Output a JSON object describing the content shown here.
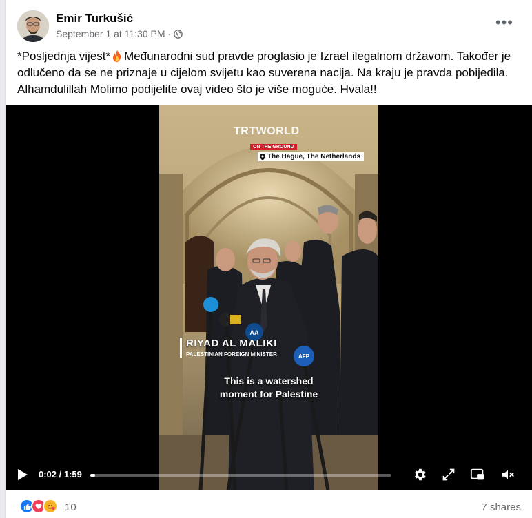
{
  "post": {
    "author": "Emir Turkušić",
    "timestamp": "September 1 at 11:30 PM",
    "separator": "·",
    "privacy_icon": "globe-icon",
    "more_label": "•••",
    "text_part1": "*Posljednja vijest*",
    "text_part2": "Međunarodni sud pravde proglasio je Izrael ilegalnom državom.  Također je odlučeno da se ne priznaje u cijelom svijetu kao suverena nacija.  Na kraju je pravda pobijedila. Alhamdulillah Molimo podijelite ovaj video što je više moguće.  Hvala!!",
    "emoji_icon": "fire-icon"
  },
  "video": {
    "brand_trt": "TRT",
    "brand_world": "WORLD",
    "on_the_ground": "ON THE GROUND",
    "location": "The Hague, The Netherlands",
    "speaker_name": "RIYAD AL MALIKI",
    "speaker_title": "PALESTINIAN FOREIGN MINISTER",
    "caption_line1": "This is a watershed",
    "caption_line2": "moment for Palestine",
    "mic_label_aa": "AA",
    "mic_label_afp": "AFP"
  },
  "controls": {
    "current_time": "0:02",
    "duration": "1:59",
    "time_sep": " / ",
    "progress_fraction": 0.017
  },
  "footer": {
    "reaction_icons": [
      "like-icon",
      "love-icon",
      "care-icon"
    ],
    "reaction_count": "10",
    "shares": "7 shares"
  },
  "colors": {
    "like": "#1877f2",
    "love": "#f33e58",
    "care": "#f7b125",
    "muted_text": "#65676b",
    "trt_red": "#d0202a"
  }
}
